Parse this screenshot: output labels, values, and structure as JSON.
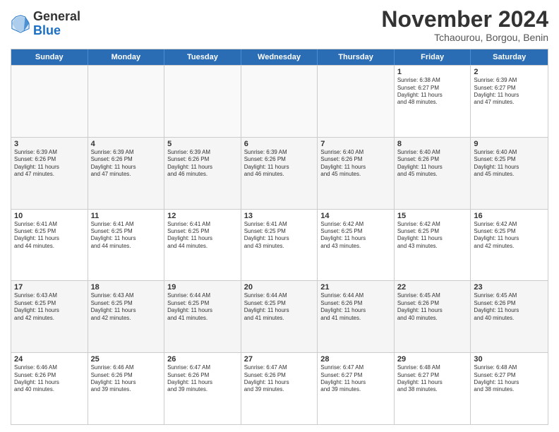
{
  "logo": {
    "general": "General",
    "blue": "Blue"
  },
  "title": "November 2024",
  "subtitle": "Tchaourou, Borgou, Benin",
  "days": [
    "Sunday",
    "Monday",
    "Tuesday",
    "Wednesday",
    "Thursday",
    "Friday",
    "Saturday"
  ],
  "rows": [
    [
      {
        "num": "",
        "info": "",
        "empty": true
      },
      {
        "num": "",
        "info": "",
        "empty": true
      },
      {
        "num": "",
        "info": "",
        "empty": true
      },
      {
        "num": "",
        "info": "",
        "empty": true
      },
      {
        "num": "",
        "info": "",
        "empty": true
      },
      {
        "num": "1",
        "info": "Sunrise: 6:38 AM\nSunset: 6:27 PM\nDaylight: 11 hours\nand 48 minutes.",
        "empty": false
      },
      {
        "num": "2",
        "info": "Sunrise: 6:39 AM\nSunset: 6:27 PM\nDaylight: 11 hours\nand 47 minutes.",
        "empty": false
      }
    ],
    [
      {
        "num": "3",
        "info": "Sunrise: 6:39 AM\nSunset: 6:26 PM\nDaylight: 11 hours\nand 47 minutes.",
        "empty": false
      },
      {
        "num": "4",
        "info": "Sunrise: 6:39 AM\nSunset: 6:26 PM\nDaylight: 11 hours\nand 47 minutes.",
        "empty": false
      },
      {
        "num": "5",
        "info": "Sunrise: 6:39 AM\nSunset: 6:26 PM\nDaylight: 11 hours\nand 46 minutes.",
        "empty": false
      },
      {
        "num": "6",
        "info": "Sunrise: 6:39 AM\nSunset: 6:26 PM\nDaylight: 11 hours\nand 46 minutes.",
        "empty": false
      },
      {
        "num": "7",
        "info": "Sunrise: 6:40 AM\nSunset: 6:26 PM\nDaylight: 11 hours\nand 45 minutes.",
        "empty": false
      },
      {
        "num": "8",
        "info": "Sunrise: 6:40 AM\nSunset: 6:26 PM\nDaylight: 11 hours\nand 45 minutes.",
        "empty": false
      },
      {
        "num": "9",
        "info": "Sunrise: 6:40 AM\nSunset: 6:25 PM\nDaylight: 11 hours\nand 45 minutes.",
        "empty": false
      }
    ],
    [
      {
        "num": "10",
        "info": "Sunrise: 6:41 AM\nSunset: 6:25 PM\nDaylight: 11 hours\nand 44 minutes.",
        "empty": false
      },
      {
        "num": "11",
        "info": "Sunrise: 6:41 AM\nSunset: 6:25 PM\nDaylight: 11 hours\nand 44 minutes.",
        "empty": false
      },
      {
        "num": "12",
        "info": "Sunrise: 6:41 AM\nSunset: 6:25 PM\nDaylight: 11 hours\nand 44 minutes.",
        "empty": false
      },
      {
        "num": "13",
        "info": "Sunrise: 6:41 AM\nSunset: 6:25 PM\nDaylight: 11 hours\nand 43 minutes.",
        "empty": false
      },
      {
        "num": "14",
        "info": "Sunrise: 6:42 AM\nSunset: 6:25 PM\nDaylight: 11 hours\nand 43 minutes.",
        "empty": false
      },
      {
        "num": "15",
        "info": "Sunrise: 6:42 AM\nSunset: 6:25 PM\nDaylight: 11 hours\nand 43 minutes.",
        "empty": false
      },
      {
        "num": "16",
        "info": "Sunrise: 6:42 AM\nSunset: 6:25 PM\nDaylight: 11 hours\nand 42 minutes.",
        "empty": false
      }
    ],
    [
      {
        "num": "17",
        "info": "Sunrise: 6:43 AM\nSunset: 6:25 PM\nDaylight: 11 hours\nand 42 minutes.",
        "empty": false
      },
      {
        "num": "18",
        "info": "Sunrise: 6:43 AM\nSunset: 6:25 PM\nDaylight: 11 hours\nand 42 minutes.",
        "empty": false
      },
      {
        "num": "19",
        "info": "Sunrise: 6:44 AM\nSunset: 6:25 PM\nDaylight: 11 hours\nand 41 minutes.",
        "empty": false
      },
      {
        "num": "20",
        "info": "Sunrise: 6:44 AM\nSunset: 6:25 PM\nDaylight: 11 hours\nand 41 minutes.",
        "empty": false
      },
      {
        "num": "21",
        "info": "Sunrise: 6:44 AM\nSunset: 6:26 PM\nDaylight: 11 hours\nand 41 minutes.",
        "empty": false
      },
      {
        "num": "22",
        "info": "Sunrise: 6:45 AM\nSunset: 6:26 PM\nDaylight: 11 hours\nand 40 minutes.",
        "empty": false
      },
      {
        "num": "23",
        "info": "Sunrise: 6:45 AM\nSunset: 6:26 PM\nDaylight: 11 hours\nand 40 minutes.",
        "empty": false
      }
    ],
    [
      {
        "num": "24",
        "info": "Sunrise: 6:46 AM\nSunset: 6:26 PM\nDaylight: 11 hours\nand 40 minutes.",
        "empty": false
      },
      {
        "num": "25",
        "info": "Sunrise: 6:46 AM\nSunset: 6:26 PM\nDaylight: 11 hours\nand 39 minutes.",
        "empty": false
      },
      {
        "num": "26",
        "info": "Sunrise: 6:47 AM\nSunset: 6:26 PM\nDaylight: 11 hours\nand 39 minutes.",
        "empty": false
      },
      {
        "num": "27",
        "info": "Sunrise: 6:47 AM\nSunset: 6:26 PM\nDaylight: 11 hours\nand 39 minutes.",
        "empty": false
      },
      {
        "num": "28",
        "info": "Sunrise: 6:47 AM\nSunset: 6:27 PM\nDaylight: 11 hours\nand 39 minutes.",
        "empty": false
      },
      {
        "num": "29",
        "info": "Sunrise: 6:48 AM\nSunset: 6:27 PM\nDaylight: 11 hours\nand 38 minutes.",
        "empty": false
      },
      {
        "num": "30",
        "info": "Sunrise: 6:48 AM\nSunset: 6:27 PM\nDaylight: 11 hours\nand 38 minutes.",
        "empty": false
      }
    ]
  ]
}
